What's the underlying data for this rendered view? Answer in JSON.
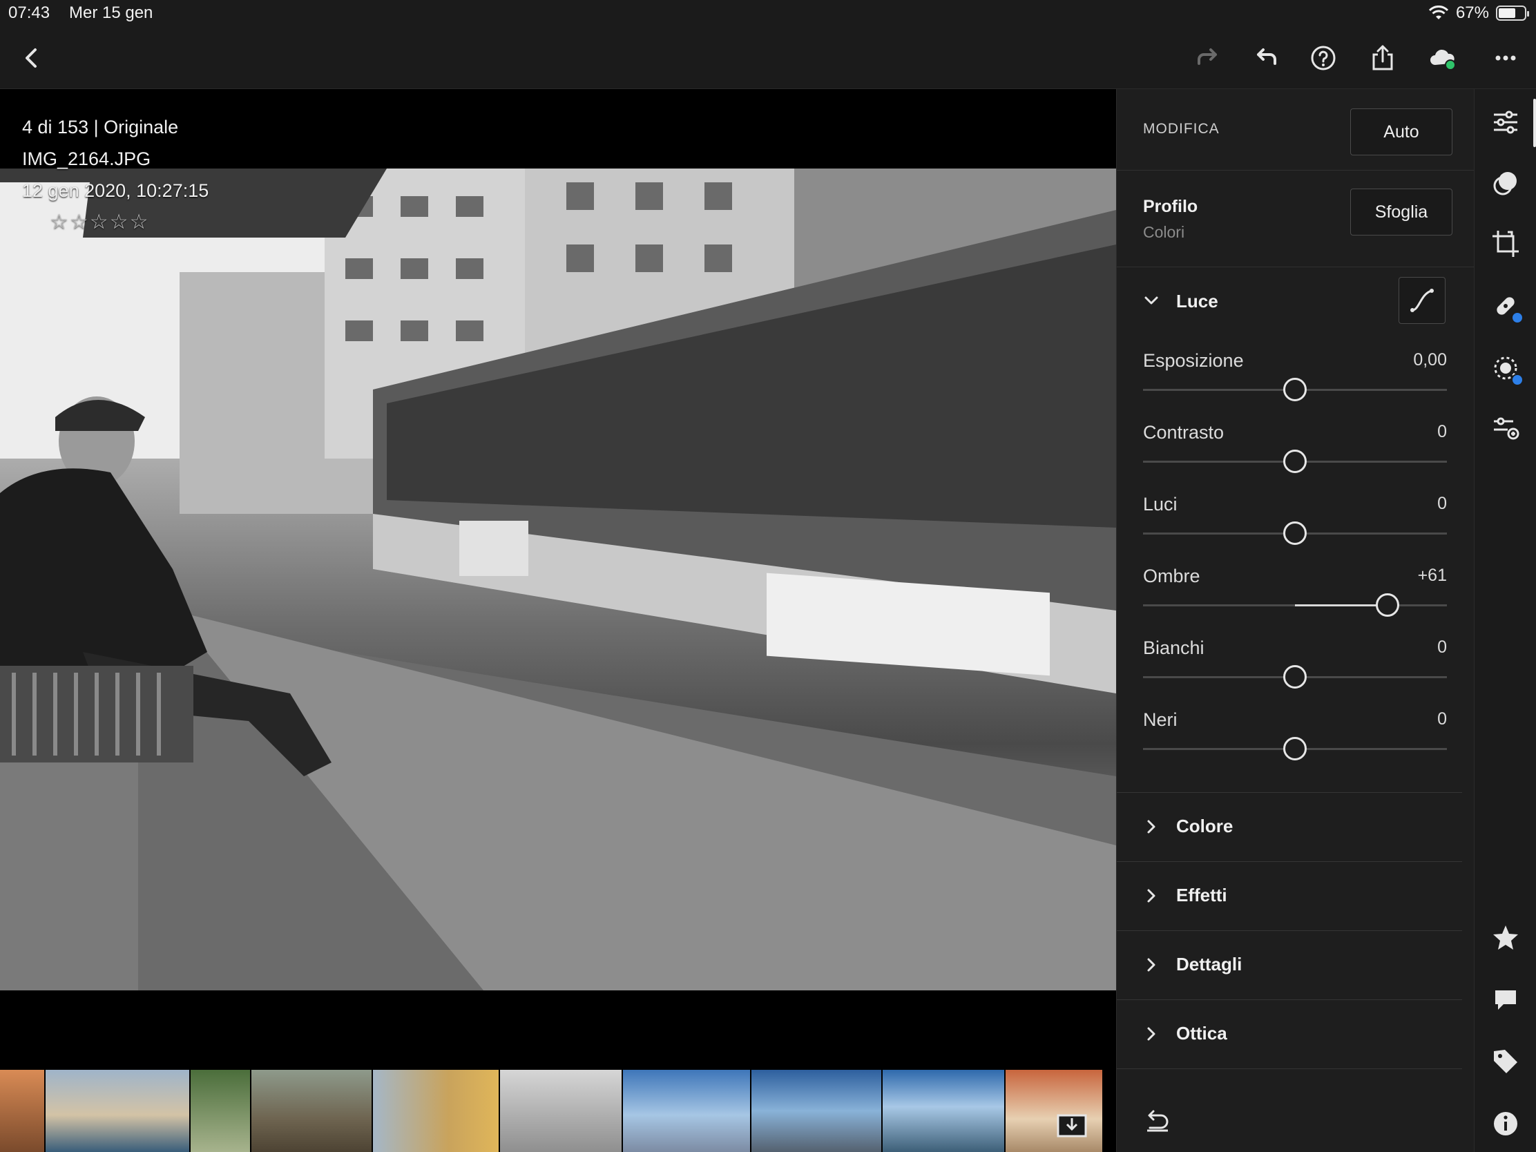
{
  "status_bar": {
    "time": "07:43",
    "date": "Mer 15 gen",
    "battery": "67%",
    "battery_level": 0.67
  },
  "toolbar": {
    "icons": [
      "back-chevron-icon",
      "redo-icon",
      "undo-icon",
      "help-icon",
      "share-icon",
      "cloud-sync-icon",
      "more-icon"
    ]
  },
  "photo": {
    "position_label": "4 di 153 | Originale",
    "filename": "IMG_2164.JPG",
    "datetime": "12 gen 2020, 10:27:15",
    "rating_stars": "☆☆☆☆☆",
    "rating": 0
  },
  "panel": {
    "title": "MODIFICA",
    "auto_label": "Auto",
    "profile_label": "Profilo",
    "profile_value": "Colori",
    "browse_label": "Sfoglia",
    "light_section": "Luce",
    "sliders": [
      {
        "name": "Esposizione",
        "value": "0,00",
        "amount": 0
      },
      {
        "name": "Contrasto",
        "value": "0",
        "amount": 0
      },
      {
        "name": "Luci",
        "value": "0",
        "amount": 0
      },
      {
        "name": "Ombre",
        "value": "+61",
        "amount": 61
      },
      {
        "name": "Bianchi",
        "value": "0",
        "amount": 0
      },
      {
        "name": "Neri",
        "value": "0",
        "amount": 0
      }
    ],
    "sections": [
      "Colore",
      "Effetti",
      "Dettagli",
      "Ottica"
    ]
  },
  "rail": {
    "icons": [
      "edit-sliders-icon",
      "presets-icon",
      "crop-icon",
      "healing-icon",
      "selective-icon",
      "versions-icon",
      "star-icon",
      "comment-icon",
      "tag-icon",
      "info-icon"
    ]
  },
  "colors": {
    "accent_green": "#2fc46a",
    "badge_blue": "#2d7fe8",
    "panel_bg": "#1e1e1e"
  }
}
